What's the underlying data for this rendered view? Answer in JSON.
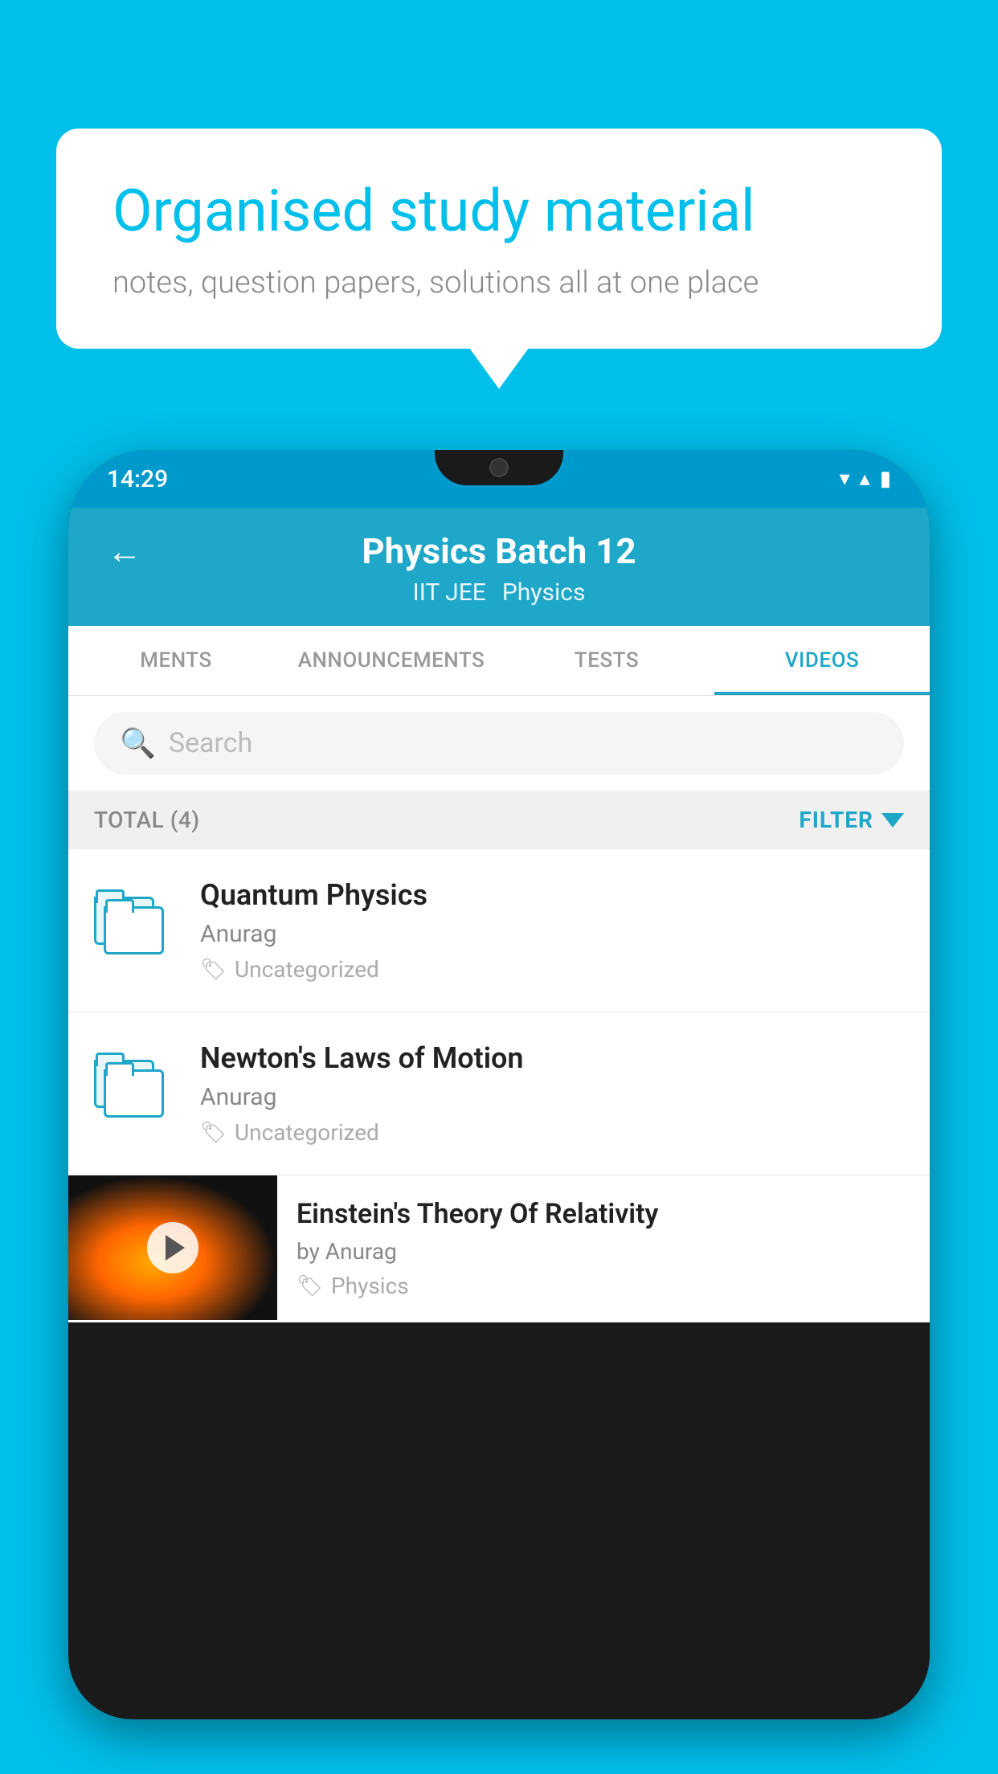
{
  "background_color": "#00BFEA",
  "speech_bubble": {
    "headline": "Organised study material",
    "subtext": "notes, question papers, solutions all at one place"
  },
  "status_bar": {
    "time": "14:29",
    "wifi_icon": "▼",
    "signal_icon": "▲",
    "battery_icon": "▮"
  },
  "app_bar": {
    "title": "Physics Batch 12",
    "subtitle_left": "IIT JEE",
    "subtitle_right": "Physics",
    "back_label": "←"
  },
  "tabs": [
    {
      "label": "MENTS",
      "active": false
    },
    {
      "label": "ANNOUNCEMENTS",
      "active": false
    },
    {
      "label": "TESTS",
      "active": false
    },
    {
      "label": "VIDEOS",
      "active": true
    }
  ],
  "search": {
    "placeholder": "Search"
  },
  "filter_bar": {
    "total_label": "TOTAL (4)",
    "filter_label": "FILTER"
  },
  "videos": [
    {
      "title": "Quantum Physics",
      "author": "Anurag",
      "tag": "Uncategorized",
      "has_thumbnail": false
    },
    {
      "title": "Newton's Laws of Motion",
      "author": "Anurag",
      "tag": "Uncategorized",
      "has_thumbnail": false
    },
    {
      "title": "Einstein's Theory Of Relativity",
      "author": "by Anurag",
      "tag": "Physics",
      "has_thumbnail": true
    }
  ]
}
